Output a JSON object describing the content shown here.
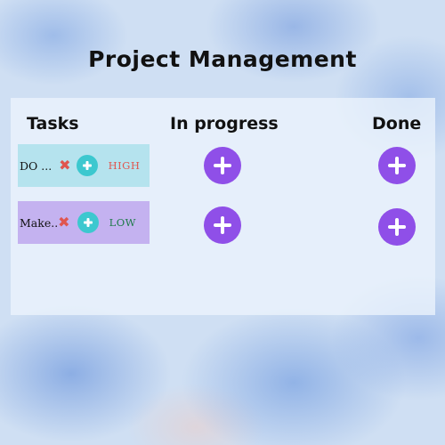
{
  "title": "Project Management",
  "columns": {
    "tasks": "Tasks",
    "in_progress": "In progress",
    "done": "Done"
  },
  "tasks": [
    {
      "text": "DO ...",
      "priority": "HIGH",
      "priority_color": "#e0564f",
      "card_color": "#b5e3ee"
    },
    {
      "text": "Make..",
      "priority": "LOW",
      "priority_color": "#1f7a4a",
      "card_color": "#c4b2f0"
    }
  ],
  "icons": {
    "delete": "x-icon",
    "add_small": "plus-circle-icon",
    "add": "plus-circle-icon"
  },
  "colors": {
    "add_button": "#8f4fe8",
    "mini_add_button": "#3cc8cf"
  }
}
